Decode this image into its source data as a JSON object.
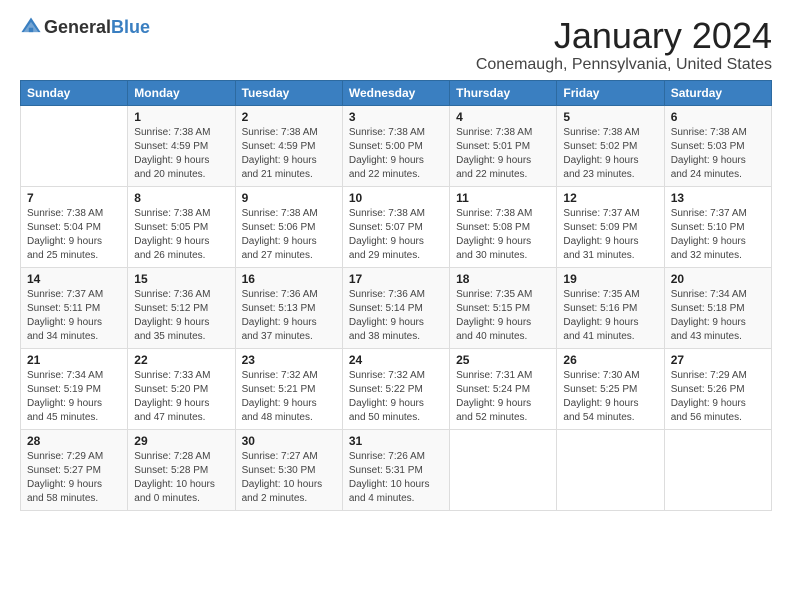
{
  "header": {
    "logo_general": "General",
    "logo_blue": "Blue",
    "month_title": "January 2024",
    "location": "Conemaugh, Pennsylvania, United States"
  },
  "days_of_week": [
    "Sunday",
    "Monday",
    "Tuesday",
    "Wednesday",
    "Thursday",
    "Friday",
    "Saturday"
  ],
  "weeks": [
    [
      {
        "day": "",
        "info": ""
      },
      {
        "day": "1",
        "info": "Sunrise: 7:38 AM\nSunset: 4:59 PM\nDaylight: 9 hours\nand 20 minutes."
      },
      {
        "day": "2",
        "info": "Sunrise: 7:38 AM\nSunset: 4:59 PM\nDaylight: 9 hours\nand 21 minutes."
      },
      {
        "day": "3",
        "info": "Sunrise: 7:38 AM\nSunset: 5:00 PM\nDaylight: 9 hours\nand 22 minutes."
      },
      {
        "day": "4",
        "info": "Sunrise: 7:38 AM\nSunset: 5:01 PM\nDaylight: 9 hours\nand 22 minutes."
      },
      {
        "day": "5",
        "info": "Sunrise: 7:38 AM\nSunset: 5:02 PM\nDaylight: 9 hours\nand 23 minutes."
      },
      {
        "day": "6",
        "info": "Sunrise: 7:38 AM\nSunset: 5:03 PM\nDaylight: 9 hours\nand 24 minutes."
      }
    ],
    [
      {
        "day": "7",
        "info": "Sunrise: 7:38 AM\nSunset: 5:04 PM\nDaylight: 9 hours\nand 25 minutes."
      },
      {
        "day": "8",
        "info": "Sunrise: 7:38 AM\nSunset: 5:05 PM\nDaylight: 9 hours\nand 26 minutes."
      },
      {
        "day": "9",
        "info": "Sunrise: 7:38 AM\nSunset: 5:06 PM\nDaylight: 9 hours\nand 27 minutes."
      },
      {
        "day": "10",
        "info": "Sunrise: 7:38 AM\nSunset: 5:07 PM\nDaylight: 9 hours\nand 29 minutes."
      },
      {
        "day": "11",
        "info": "Sunrise: 7:38 AM\nSunset: 5:08 PM\nDaylight: 9 hours\nand 30 minutes."
      },
      {
        "day": "12",
        "info": "Sunrise: 7:37 AM\nSunset: 5:09 PM\nDaylight: 9 hours\nand 31 minutes."
      },
      {
        "day": "13",
        "info": "Sunrise: 7:37 AM\nSunset: 5:10 PM\nDaylight: 9 hours\nand 32 minutes."
      }
    ],
    [
      {
        "day": "14",
        "info": "Sunrise: 7:37 AM\nSunset: 5:11 PM\nDaylight: 9 hours\nand 34 minutes."
      },
      {
        "day": "15",
        "info": "Sunrise: 7:36 AM\nSunset: 5:12 PM\nDaylight: 9 hours\nand 35 minutes."
      },
      {
        "day": "16",
        "info": "Sunrise: 7:36 AM\nSunset: 5:13 PM\nDaylight: 9 hours\nand 37 minutes."
      },
      {
        "day": "17",
        "info": "Sunrise: 7:36 AM\nSunset: 5:14 PM\nDaylight: 9 hours\nand 38 minutes."
      },
      {
        "day": "18",
        "info": "Sunrise: 7:35 AM\nSunset: 5:15 PM\nDaylight: 9 hours\nand 40 minutes."
      },
      {
        "day": "19",
        "info": "Sunrise: 7:35 AM\nSunset: 5:16 PM\nDaylight: 9 hours\nand 41 minutes."
      },
      {
        "day": "20",
        "info": "Sunrise: 7:34 AM\nSunset: 5:18 PM\nDaylight: 9 hours\nand 43 minutes."
      }
    ],
    [
      {
        "day": "21",
        "info": "Sunrise: 7:34 AM\nSunset: 5:19 PM\nDaylight: 9 hours\nand 45 minutes."
      },
      {
        "day": "22",
        "info": "Sunrise: 7:33 AM\nSunset: 5:20 PM\nDaylight: 9 hours\nand 47 minutes."
      },
      {
        "day": "23",
        "info": "Sunrise: 7:32 AM\nSunset: 5:21 PM\nDaylight: 9 hours\nand 48 minutes."
      },
      {
        "day": "24",
        "info": "Sunrise: 7:32 AM\nSunset: 5:22 PM\nDaylight: 9 hours\nand 50 minutes."
      },
      {
        "day": "25",
        "info": "Sunrise: 7:31 AM\nSunset: 5:24 PM\nDaylight: 9 hours\nand 52 minutes."
      },
      {
        "day": "26",
        "info": "Sunrise: 7:30 AM\nSunset: 5:25 PM\nDaylight: 9 hours\nand 54 minutes."
      },
      {
        "day": "27",
        "info": "Sunrise: 7:29 AM\nSunset: 5:26 PM\nDaylight: 9 hours\nand 56 minutes."
      }
    ],
    [
      {
        "day": "28",
        "info": "Sunrise: 7:29 AM\nSunset: 5:27 PM\nDaylight: 9 hours\nand 58 minutes."
      },
      {
        "day": "29",
        "info": "Sunrise: 7:28 AM\nSunset: 5:28 PM\nDaylight: 10 hours\nand 0 minutes."
      },
      {
        "day": "30",
        "info": "Sunrise: 7:27 AM\nSunset: 5:30 PM\nDaylight: 10 hours\nand 2 minutes."
      },
      {
        "day": "31",
        "info": "Sunrise: 7:26 AM\nSunset: 5:31 PM\nDaylight: 10 hours\nand 4 minutes."
      },
      {
        "day": "",
        "info": ""
      },
      {
        "day": "",
        "info": ""
      },
      {
        "day": "",
        "info": ""
      }
    ]
  ]
}
